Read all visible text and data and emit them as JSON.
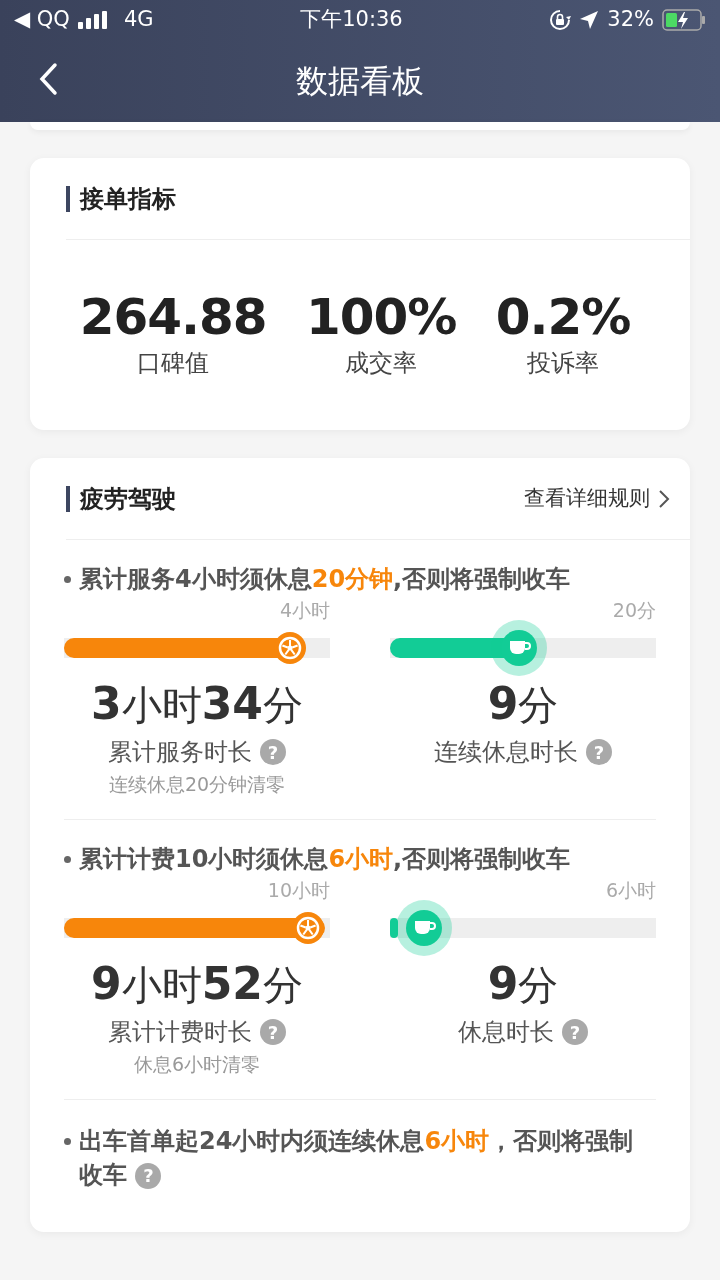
{
  "status_bar": {
    "back_app": "◀ QQ",
    "network": "4G",
    "time": "下午10:36",
    "battery": "32%"
  },
  "nav": {
    "title": "数据看板"
  },
  "order_metrics": {
    "title": "接单指标",
    "metrics": [
      {
        "value": "264.88",
        "label": "口碑值"
      },
      {
        "value": "100%",
        "label": "成交率"
      },
      {
        "value": "0.2%",
        "label": "投诉率"
      }
    ]
  },
  "fatigue": {
    "title": "疲劳驾驶",
    "link": "查看详细规则",
    "sections": [
      {
        "rule": {
          "before": "累计服务4小时须休息",
          "emphasis": "20分钟",
          "after": ",否则将强制收车"
        },
        "meters": [
          {
            "kind": "service",
            "max_label": "4小时",
            "level": 0.9,
            "value": "3小时34分",
            "label": "累计服务时长",
            "help": "?",
            "note": "连续休息20分钟清零"
          },
          {
            "kind": "rest",
            "max_label": "20分",
            "level": 0.48,
            "value": "9分",
            "label": "连续休息时长",
            "help": "?"
          }
        ]
      },
      {
        "rule": {
          "before": "累计计费10小时须休息",
          "emphasis": "6小时",
          "after": ",否则将强制收车"
        },
        "meters": [
          {
            "kind": "service",
            "max_label": "10小时",
            "level": 0.98,
            "value": "9小时52分",
            "label": "累计计费时长",
            "help": "?",
            "note": "休息6小时清零"
          },
          {
            "kind": "rest",
            "max_label": "6小时",
            "level": 0.03,
            "value": "9分",
            "label": "休息时长",
            "help": "?"
          }
        ]
      },
      {
        "rule": {
          "before": "出车首单起24小时内须连续休息",
          "emphasis": "6小时",
          "after": "，否则将强制收车"
        },
        "help": "?"
      }
    ]
  }
}
